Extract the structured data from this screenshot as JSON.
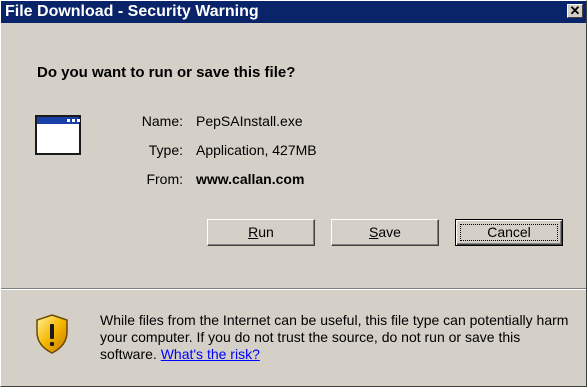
{
  "window": {
    "title": "File Download - Security Warning",
    "close_glyph": "✕"
  },
  "prompt": {
    "question": "Do you want to run or save this file?"
  },
  "file": {
    "icon": "application-window-icon",
    "name_label": "Name:",
    "name_value": "PepSAInstall.exe",
    "type_label": "Type:",
    "type_value": "Application, 427MB",
    "from_label": "From:",
    "from_value": "www.callan.com"
  },
  "buttons": {
    "run_access": "R",
    "run_rest": "un",
    "save_access": "S",
    "save_rest": "ave",
    "cancel_label": "Cancel"
  },
  "warning": {
    "icon": "security-shield-icon",
    "text": "While files from the Internet can be useful, this file type can potentially harm your computer. If you do not trust the source, do not run or save this software. ",
    "link": "What's the risk?"
  },
  "colors": {
    "titlebar": "#0a246a",
    "dialog_bg": "#d4d0c8",
    "link": "#0000ff"
  }
}
